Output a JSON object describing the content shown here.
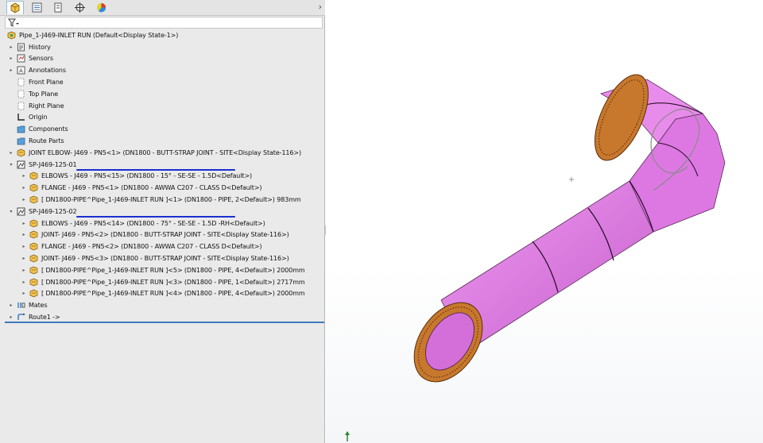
{
  "tree": {
    "root": "Pipe_1-J469-INLET RUN  (Default<Display State-1>)",
    "items": [
      {
        "label": "History",
        "icon": "history-icon"
      },
      {
        "label": "Sensors",
        "icon": "sensors-icon"
      },
      {
        "label": "Annotations",
        "icon": "annotations-icon"
      },
      {
        "label": "Front Plane",
        "icon": "plane-icon"
      },
      {
        "label": "Top Plane",
        "icon": "plane-icon"
      },
      {
        "label": "Right Plane",
        "icon": "plane-icon"
      },
      {
        "label": "Origin",
        "icon": "origin-icon"
      },
      {
        "label": "Components",
        "icon": "folder-icon"
      },
      {
        "label": "Route Parts",
        "icon": "folder-icon"
      },
      {
        "label": "JOINT ELBOW- J469 - PN5<1> (DN1800 - BUTT-STRAP JOINT - SITE<Display State-116>)",
        "icon": "part-icon"
      },
      {
        "label": "SP-J469-125-01",
        "icon": "subassembly-icon"
      },
      {
        "label": "ELBOWS - J469 - PN5<15> (DN1800 - 15° - SE-SE - 1.5D<Default>)",
        "icon": "part-icon"
      },
      {
        "label": "FLANGE - J469 - PN5<1> (DN1800 - AWWA C207 - CLASS D<Default>)",
        "icon": "part-icon"
      },
      {
        "label": "[ DN1800-PIPE^Pipe_1-J469-INLET RUN ]<1> (DN1800 - PIPE, 2<Default>) 983mm",
        "icon": "part-icon"
      },
      {
        "label": "SP-J469-125-02",
        "icon": "subassembly-icon"
      },
      {
        "label": "ELBOWS - J469 - PN5<14> (DN1800 - 75° - SE-SE - 1.5D -RH<Default>)",
        "icon": "part-icon"
      },
      {
        "label": "JOINT- J469 - PN5<2> (DN1800 - BUTT-STRAP JOINT - SITE<Display State-116>)",
        "icon": "part-icon"
      },
      {
        "label": "FLANGE - J469 - PN5<2> (DN1800 - AWWA C207 - CLASS D<Default>)",
        "icon": "part-icon"
      },
      {
        "label": "JOINT- J469 - PN5<3> (DN1800 - BUTT-STRAP JOINT - SITE<Display State-116>)",
        "icon": "part-icon"
      },
      {
        "label": "[ DN1800-PIPE^Pipe_1-J469-INLET RUN ]<5> (DN1800 - PIPE, 4<Default>) 2000mm",
        "icon": "part-icon"
      },
      {
        "label": "[ DN1800-PIPE^Pipe_1-J469-INLET RUN ]<3> (DN1800 - PIPE, 1<Default>) 2717mm",
        "icon": "part-icon"
      },
      {
        "label": "[ DN1800-PIPE^Pipe_1-J469-INLET RUN ]<4> (DN1800 - PIPE, 4<Default>) 2000mm",
        "icon": "part-icon"
      },
      {
        "label": "Mates",
        "icon": "mates-icon"
      },
      {
        "label": "Route1 ->",
        "icon": "route-icon"
      }
    ]
  },
  "colors": {
    "pipe": "#e07ee6",
    "pipe_dark": "#c25ec9",
    "flange": "#c8782d",
    "flange_dark": "#8a4a14",
    "highlight": "#3f79c0"
  }
}
